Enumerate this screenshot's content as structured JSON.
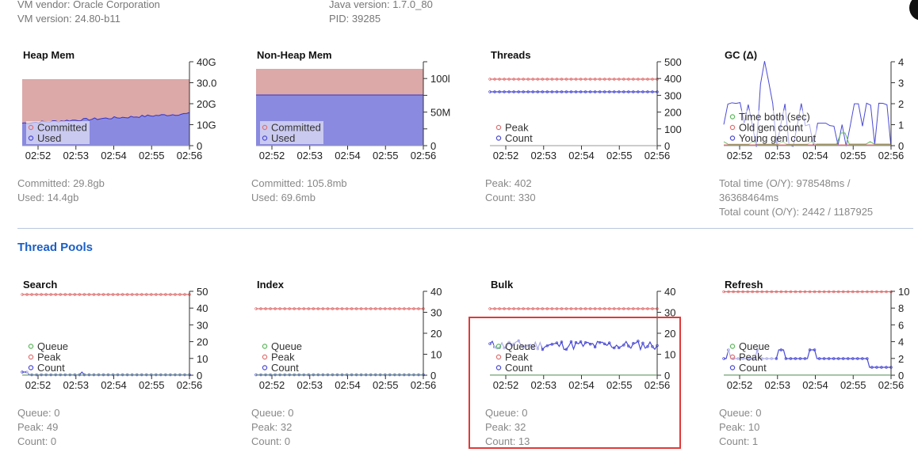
{
  "header": {
    "vm_vendor": "VM vendor: Oracle Corporation",
    "vm_version": "VM version: 24.80-b11",
    "java_version": "Java version: 1.7.0_80",
    "pid": "PID: 39285"
  },
  "time_ticks": [
    "02:52",
    "02:53",
    "02:54",
    "02:55",
    "02:56"
  ],
  "colors": {
    "red": "#e07070",
    "blue": "#4a4ad6",
    "green": "#5cb85c",
    "fill_red": "#dca8a8",
    "fill_blue": "#8a8ae0"
  },
  "panels": {
    "heap": {
      "title": "Heap Mem",
      "y_ticks": [
        "40G",
        "30.0",
        "20G",
        "10G",
        "0"
      ],
      "legend": [
        "Committed",
        "Used"
      ],
      "stats": [
        "Committed: 29.8gb",
        "Used: 14.4gb"
      ]
    },
    "nonheap": {
      "title": "Non-Heap Mem",
      "y_ticks": [
        "100l",
        "50M",
        "0"
      ],
      "legend": [
        "Committed",
        "Used"
      ],
      "stats": [
        "Committed: 105.8mb",
        "Used: 69.6mb"
      ]
    },
    "threads": {
      "title": "Threads",
      "y_ticks": [
        "500",
        "400",
        "300",
        "200",
        "100",
        "0"
      ],
      "legend": [
        "Peak",
        "Count"
      ],
      "stats": [
        "Peak: 402",
        "Count: 330"
      ]
    },
    "gc": {
      "title": "GC (Δ)",
      "y_ticks": [
        "4",
        "3",
        "2",
        "1",
        "0"
      ],
      "legend": [
        "Time both (sec)",
        "Old gen count",
        "Young gen count"
      ],
      "stats": [
        "Total time (O/Y): 978548ms /",
        "36368464ms",
        "Total count (O/Y): 2442 / 1187925"
      ]
    }
  },
  "thread_pools": {
    "heading": "Thread Pools",
    "search": {
      "title": "Search",
      "y_ticks": [
        "50",
        "40",
        "30",
        "20",
        "10",
        "0"
      ],
      "legend": [
        "Queue",
        "Peak",
        "Count"
      ],
      "stats": [
        "Queue: 0",
        "Peak: 49",
        "Count: 0"
      ]
    },
    "index": {
      "title": "Index",
      "y_ticks": [
        "40",
        "30",
        "20",
        "10",
        "0"
      ],
      "legend": [
        "Queue",
        "Peak",
        "Count"
      ],
      "stats": [
        "Queue: 0",
        "Peak: 32",
        "Count: 0"
      ]
    },
    "bulk": {
      "title": "Bulk",
      "y_ticks": [
        "40",
        "30",
        "20",
        "10",
        "0"
      ],
      "legend": [
        "Queue",
        "Peak",
        "Count"
      ],
      "stats": [
        "Queue: 0",
        "Peak: 32",
        "Count: 13"
      ]
    },
    "refresh": {
      "title": "Refresh",
      "y_ticks": [
        "10",
        "8",
        "6",
        "4",
        "2",
        "0"
      ],
      "legend": [
        "Queue",
        "Peak",
        "Count"
      ],
      "stats": [
        "Queue: 0",
        "Peak: 10",
        "Count: 1"
      ]
    }
  }
}
